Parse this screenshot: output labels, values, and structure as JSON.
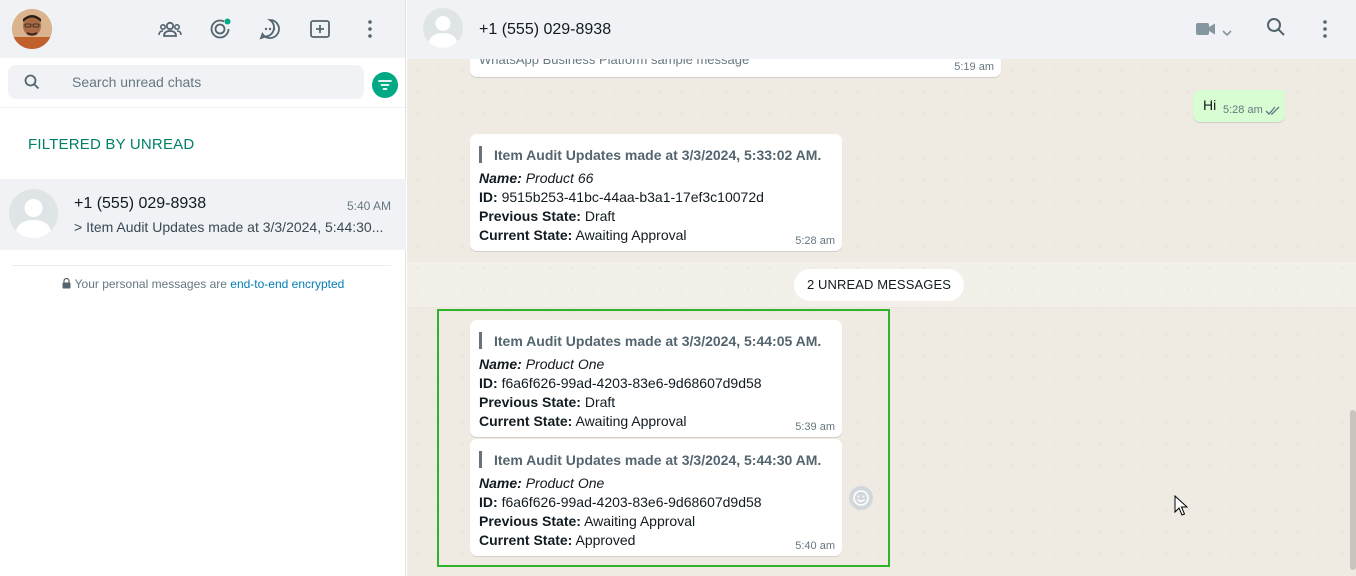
{
  "sidebar": {
    "search_placeholder": "Search unread chats",
    "filter_label": "FILTERED BY UNREAD",
    "chats": [
      {
        "name": "+1 (555) 029-8938",
        "time": "5:40 AM",
        "preview": "> Item Audit Updates made at 3/3/2024, 5:44:30..."
      }
    ],
    "encryption_text": "Your personal messages are ",
    "encryption_link": "end-to-end encrypted"
  },
  "conversation": {
    "contact_name": "+1 (555) 029-8938",
    "messages": {
      "sample": {
        "text": "WhatsApp Business Platform sample message",
        "time": "5:19 am"
      },
      "hi": {
        "text": "Hi",
        "time": "5:28 am"
      },
      "audit_1": {
        "heading": "Item Audit Updates made at 3/3/2024, 5:33:02 AM.",
        "name_label": "Name:",
        "name_value": "Product 66",
        "id_label": "ID:",
        "id_value": "9515b253-41bc-44aa-b3a1-17ef3c10072d",
        "prev_label": "Previous State:",
        "prev_value": "Draft",
        "curr_label": "Current State:",
        "curr_value": "Awaiting Approval",
        "time": "5:28 am"
      },
      "audit_2": {
        "heading": "Item Audit Updates made at 3/3/2024, 5:44:05 AM.",
        "name_label": "Name:",
        "name_value": "Product One",
        "id_label": "ID:",
        "id_value": "f6a6f626-99ad-4203-83e6-9d68607d9d58",
        "prev_label": "Previous State:",
        "prev_value": "Draft",
        "curr_label": "Current State:",
        "curr_value": "Awaiting Approval",
        "time": "5:39 am"
      },
      "audit_3": {
        "heading": "Item Audit Updates made at 3/3/2024, 5:44:30 AM.",
        "name_label": "Name:",
        "name_value": "Product One",
        "id_label": "ID:",
        "id_value": "f6a6f626-99ad-4203-83e6-9d68607d9d58",
        "prev_label": "Previous State:",
        "prev_value": "Awaiting Approval",
        "curr_label": "Current State:",
        "curr_value": "Approved",
        "time": "5:40 am"
      }
    },
    "unread_divider": "2 UNREAD MESSAGES"
  },
  "colors": {
    "accent": "#00a884",
    "highlight_border": "#2fb32a",
    "outgoing_bubble": "#d9fdd3",
    "chat_background": "#efeae2"
  },
  "icons": [
    "communities-icon",
    "status-icon",
    "channels-icon",
    "new-chat-icon",
    "menu-icon",
    "search-icon",
    "filter-icon",
    "lock-icon",
    "video-call-icon",
    "chevron-down-icon",
    "double-check-icon",
    "emoji-icon",
    "mouse-cursor-icon"
  ]
}
